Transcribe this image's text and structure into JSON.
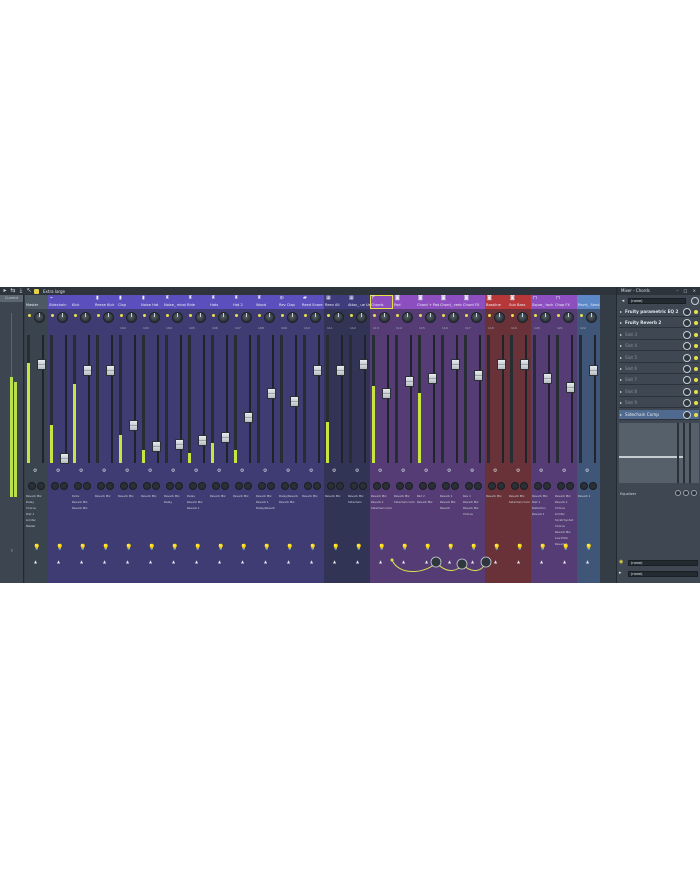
{
  "toolbar": {
    "layout_name": "Extra large"
  },
  "left_meter": {
    "label": "Current"
  },
  "panel": {
    "title": "Mixer - Chords",
    "window_buttons": "– □ ×",
    "preset": "(none)",
    "slots": [
      {
        "name": "Fruity parametric EQ 2",
        "state": "active"
      },
      {
        "name": "Fruity Reverb 2",
        "state": "active"
      },
      {
        "name": "Slot 3",
        "state": "empty"
      },
      {
        "name": "Slot 4",
        "state": "empty"
      },
      {
        "name": "Slot 5",
        "state": "empty"
      },
      {
        "name": "Slot 6",
        "state": "empty"
      },
      {
        "name": "Slot 7",
        "state": "empty"
      },
      {
        "name": "Slot 8",
        "state": "empty"
      },
      {
        "name": "Slot 9",
        "state": "empty"
      },
      {
        "name": "Sidechain Comp",
        "state": "sidechain"
      }
    ],
    "equalizer_label": "Equalizer",
    "output_in": "(none)",
    "output_out": "(none)"
  },
  "strips": [
    {
      "name": "Master",
      "icon": "",
      "color": "#4d5a66",
      "fader": 0.8,
      "vu": 0.78,
      "num": "",
      "routes": [
        "Reverb Mix",
        "Delay",
        "Chorus",
        "Dist 1",
        "Limiter",
        "Master"
      ]
    },
    {
      "name": "Sidechain",
      "icon": "⌁",
      "color": "#5a4fbc",
      "fader": 0.0,
      "vu": 0.3,
      "num": "",
      "routes": []
    },
    {
      "name": "Kick",
      "icon": "",
      "color": "#5a4fbc",
      "fader": 0.75,
      "vu": 0.62,
      "num": "",
      "routes": [
        "Kicks",
        "Reverb Mix",
        "Reverb Mix"
      ]
    },
    {
      "name": "Reese Kick",
      "icon": "▮",
      "color": "#5a4fbc",
      "fader": 0.75,
      "vu": 0.0,
      "num": "",
      "routes": [
        "Reverb Mix"
      ]
    },
    {
      "name": "Clap",
      "icon": "▮",
      "color": "#5a4fbc",
      "fader": 0.28,
      "vu": 0.22,
      "num": "102",
      "routes": [
        "Reverb Mix"
      ]
    },
    {
      "name": "Noise Hat",
      "icon": "▮",
      "color": "#5a4fbc",
      "fader": 0.1,
      "vu": 0.1,
      "num": "103",
      "routes": [
        "Reverb Mix"
      ]
    },
    {
      "name": "Noise_ mbal",
      "icon": "♜",
      "color": "#5a4fbc",
      "fader": 0.12,
      "vu": 0.0,
      "num": "104",
      "routes": [
        "Reverb Mix",
        "Delay"
      ]
    },
    {
      "name": "Ride",
      "icon": "♜",
      "color": "#5a4fbc",
      "fader": 0.15,
      "vu": 0.08,
      "num": "105",
      "routes": [
        "Delay",
        "Reverb Mix",
        "Reverb 1"
      ]
    },
    {
      "name": "Hats",
      "icon": "♜",
      "color": "#5a4fbc",
      "fader": 0.18,
      "vu": 0.16,
      "num": "106",
      "routes": [
        "Reverb Mix"
      ]
    },
    {
      "name": "Hat 2",
      "icon": "♜",
      "color": "#5a4fbc",
      "fader": 0.35,
      "vu": 0.1,
      "num": "107",
      "routes": [
        "Reverb Mix"
      ]
    },
    {
      "name": "Wood",
      "icon": "♜",
      "color": "#5a4fbc",
      "fader": 0.55,
      "vu": 0.0,
      "num": "108",
      "routes": [
        "Reverb Mix",
        "Reverb 1",
        "Delay/Reverb"
      ]
    },
    {
      "name": "Rev Clap",
      "icon": "⦶",
      "color": "#5a4fbc",
      "fader": 0.48,
      "vu": 0.0,
      "num": "109",
      "routes": [
        "Delay/Reverb",
        "Reverb Mix"
      ]
    },
    {
      "name": "Reed Snare",
      "icon": "▰",
      "color": "#5a4fbc",
      "fader": 0.75,
      "vu": 0.0,
      "num": "110",
      "routes": [
        "Reverb Mix"
      ]
    },
    {
      "name": "Reev All",
      "icon": "▦",
      "color": "#3e3c7c",
      "fader": 0.75,
      "vu": 0.32,
      "num": "111",
      "routes": [
        "Reverb Mix"
      ]
    },
    {
      "name": "Attac_ ue Us",
      "icon": "▦",
      "color": "#3e3c7c",
      "fader": 0.8,
      "vu": 0.0,
      "num": "112",
      "routes": [
        "Reverb Mix",
        "Sidechain"
      ]
    },
    {
      "name": "Chords",
      "icon": "F",
      "color": "#8d4fbf",
      "fader": 0.55,
      "vu": 0.6,
      "num": "113",
      "routes": [
        "Reverb Mix",
        "Reverb 1",
        "Sidechain Comp"
      ],
      "selected": true
    },
    {
      "name": "Pad",
      "icon": "◙",
      "color": "#8d4fbf",
      "fader": 0.65,
      "vu": 0.0,
      "num": "114",
      "routes": [
        "Reverb Mix",
        "Sidechain Comp"
      ]
    },
    {
      "name": "Chord + Pad",
      "icon": "◙",
      "color": "#8d4fbf",
      "fader": 0.68,
      "vu": 0.55,
      "num": "115",
      "routes": [
        "Pad 2",
        "Reverb Mix"
      ]
    },
    {
      "name": "Chord_ verb",
      "icon": "◙",
      "color": "#8d4fbf",
      "fader": 0.8,
      "vu": 0.0,
      "num": "116",
      "routes": [
        "Reverb 1",
        "Reverb Mix",
        "Reverb"
      ]
    },
    {
      "name": "Chord FX",
      "icon": "◙",
      "color": "#8d4fbf",
      "fader": 0.7,
      "vu": 0.0,
      "num": "117",
      "routes": [
        "Rev 1",
        "Reverb Mix",
        "Reverb Mix",
        "Chorus"
      ]
    },
    {
      "name": "Bassline",
      "icon": "◙",
      "color": "#b8383a",
      "fader": 0.8,
      "vu": 0.0,
      "num": "118",
      "routes": [
        "Reverb Mix"
      ]
    },
    {
      "name": "Sub Bass",
      "icon": "◙",
      "color": "#b8383a",
      "fader": 0.8,
      "vu": 0.0,
      "num": "119",
      "routes": [
        "Reverb Mix",
        "Sidechain Comp"
      ]
    },
    {
      "name": "Squar_ tack",
      "icon": "⊓",
      "color": "#8d4fbf",
      "fader": 0.68,
      "vu": 0.0,
      "num": "120",
      "routes": [
        "Reverb Mix",
        "Dist 1",
        "Distortion",
        "Reverb 1"
      ]
    },
    {
      "name": "Chop FX",
      "icon": "⊓",
      "color": "#8d4fbf",
      "fader": 0.6,
      "vu": 0.0,
      "num": "121",
      "routes": [
        "Reverb Mix",
        "Reverb 1",
        "Chorus",
        "Limiter",
        "Scratchyshot",
        "Chorus",
        "Reverb Mix",
        "Low Pitch",
        "Reverb 1"
      ]
    },
    {
      "name": "Revrt_ Send",
      "icon": "",
      "color": "#5c88c8",
      "fader": 0.75,
      "vu": 0.0,
      "num": "122",
      "routes": [
        "Reverb 1"
      ]
    }
  ]
}
